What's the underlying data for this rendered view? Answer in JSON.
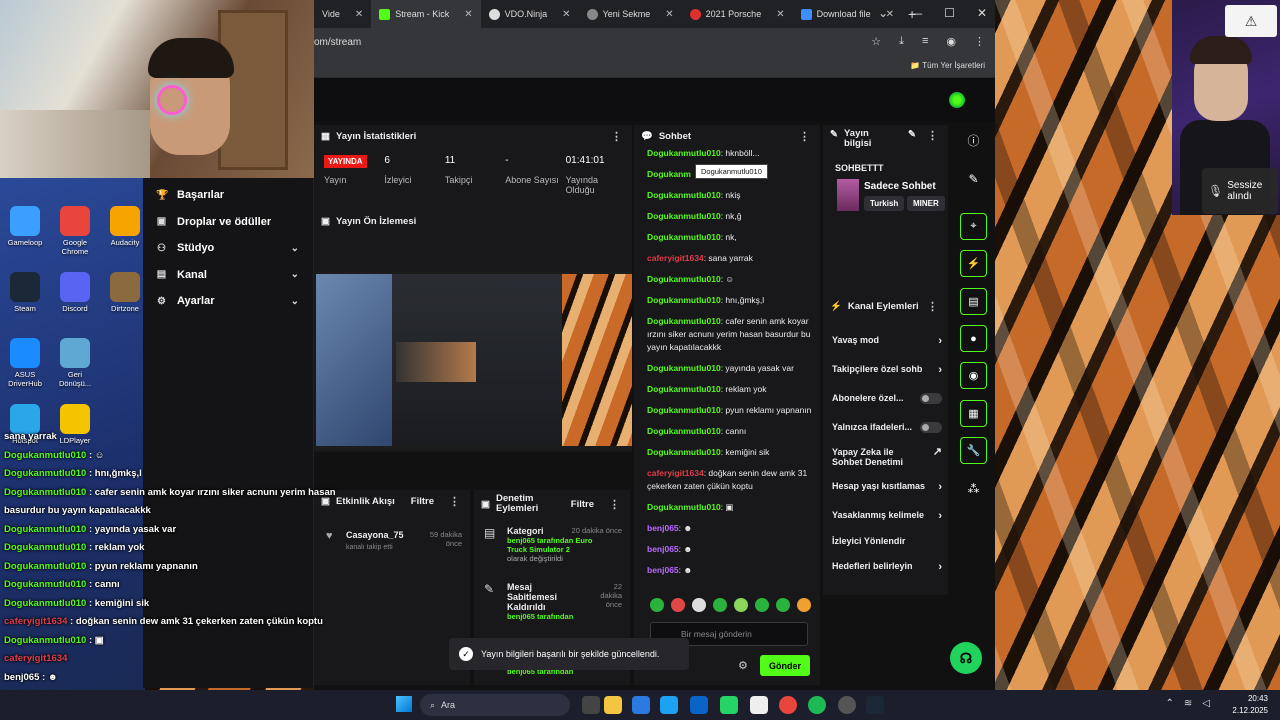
{
  "browser": {
    "tabs": [
      {
        "label": "Vide",
        "active": false
      },
      {
        "label": "Stream - Kick",
        "active": true
      },
      {
        "label": "VDO.Ninja",
        "active": false
      },
      {
        "label": "Yeni Sekme",
        "active": false
      },
      {
        "label": "2021 Porsche",
        "active": false
      },
      {
        "label": "Download file",
        "active": false
      }
    ],
    "url": "om/stream",
    "bookmarks_all": "Tüm Yer İşaretleri"
  },
  "sidemenu": {
    "items": [
      {
        "label": "Başarılar",
        "icon": "trophy-icon"
      },
      {
        "label": "Droplar ve ödüller",
        "icon": "gift-icon"
      },
      {
        "label": "Stüdyo",
        "icon": "studio-icon"
      },
      {
        "label": "Kanal",
        "icon": "channel-icon"
      },
      {
        "label": "Ayarlar",
        "icon": "gear-icon"
      }
    ]
  },
  "stats": {
    "title": "Yayın İstatistikleri",
    "live_label": "YAYINDA",
    "live_caption": "Yayın",
    "viewers": "6",
    "viewers_label": "İzleyici",
    "followers": "11",
    "followers_label": "Takipçi",
    "subs": "-",
    "subs_label": "Abone Sayısı",
    "duration": "01:41:01",
    "duration_label": "Yayında Olduğu"
  },
  "preview": {
    "title": "Yayın Ön İzlemesi"
  },
  "activity": {
    "title": "Etkinlik Akışı",
    "filter": "Filtre",
    "item_name": "Casayona_75",
    "item_sub": "kanalı takip etti",
    "item_time": "59 dakika önce"
  },
  "moderation": {
    "title": "Denetim Eylemleri",
    "filter": "Filtre",
    "items": [
      {
        "title": "Kategori",
        "who": "benj065 tarafından Euro Truck Simulator 2",
        "desc": "olarak değiştirildi",
        "time": "20 dakika önce"
      },
      {
        "title": "Mesaj Sabitlemesi Kaldırıldı",
        "who": "benj065 tarafından",
        "desc": "",
        "time": "22 dakika önce"
      }
    ],
    "extra_who": "benj065 tarafından"
  },
  "chat": {
    "title": "Sohbet",
    "tooltip": "Dogukanmutlu010",
    "messages": [
      {
        "user": "Dogukanmutlu010",
        "text": ": hknböll...",
        "color": "green"
      },
      {
        "user": "Dogukanm",
        "text": "",
        "color": "green"
      },
      {
        "user": "Dogukanmutlu010",
        "text": ": nkiş",
        "color": "green"
      },
      {
        "user": "Dogukanmutlu010",
        "text": ": nk,ğ",
        "color": "green"
      },
      {
        "user": "Dogukanmutlu010",
        "text": ": nk,",
        "color": "green"
      },
      {
        "user": "caferyigit1634",
        "text": ": sana yarrak",
        "color": "red"
      },
      {
        "user": "Dogukanmutlu010",
        "text": ": ☺",
        "color": "green"
      },
      {
        "user": "Dogukanmutlu010",
        "text": ": hnı,ğmkş,l",
        "color": "green"
      },
      {
        "user": "Dogukanmutlu010",
        "text": ": cafer senin amk koyar ırzını siker acnunı yerim hasan basurdur bu yayın kapatılacakkk",
        "color": "green"
      },
      {
        "user": "Dogukanmutlu010",
        "text": ": yayında yasak var",
        "color": "green"
      },
      {
        "user": "Dogukanmutlu010",
        "text": ": reklam yok",
        "color": "green"
      },
      {
        "user": "Dogukanmutlu010",
        "text": ": pyun reklamı yapnanın",
        "color": "green"
      },
      {
        "user": "Dogukanmutlu010",
        "text": ": cannı",
        "color": "green"
      },
      {
        "user": "Dogukanmutlu010",
        "text": ": kemiğini sik",
        "color": "green"
      },
      {
        "user": "caferyigit1634",
        "text": ": doğkan senin dew amk 31 çekerken zaten çükün koptu",
        "color": "red"
      },
      {
        "user": "Dogukanmutlu010",
        "text": ": ▣",
        "color": "green"
      },
      {
        "user": "benj065",
        "text": ": ☻",
        "color": "purple"
      },
      {
        "user": "benj065",
        "text": ": ☻",
        "color": "purple"
      },
      {
        "user": "benj065",
        "text": ": ☻",
        "color": "purple"
      }
    ],
    "input_placeholder": "Bir mesaj gönderin",
    "send": "Gönder"
  },
  "info": {
    "title_line1": "Yayın",
    "title_line2": "bilgisi",
    "stream_title": "SOHBETTT",
    "category": "Sadece Sohbet",
    "tags": [
      "Turkish",
      "MINER"
    ]
  },
  "actions": {
    "title": "Kanal Eylemleri",
    "items": [
      {
        "label": "Yavaş mod",
        "kind": "chevron"
      },
      {
        "label": "Takipçilere özel sohb",
        "kind": "chevron"
      },
      {
        "label": "Abonelere özel...",
        "kind": "toggle"
      },
      {
        "label": "Yalnızca ifadeleri...",
        "kind": "toggle"
      },
      {
        "label": "Yapay Zeka ile Sohbet Denetimi",
        "kind": "external"
      },
      {
        "label": "Hesap yaşı kısıtlamas",
        "kind": "chevron"
      },
      {
        "label": "Yasaklanmış kelimele",
        "kind": "chevron"
      },
      {
        "label": "İzleyici Yönlendir",
        "kind": "none"
      },
      {
        "label": "Hedefleri belirleyin",
        "kind": "chevron"
      }
    ]
  },
  "toast": {
    "text": "Yayın bilgileri başarılı bir şekilde güncellendi."
  },
  "webcam": {
    "mute_text": "Sessize alındı"
  },
  "desktop_icons": [
    {
      "label": "Gameloop",
      "color": "#3aa0ff"
    },
    {
      "label": "Google Chrome",
      "color": "#e8453c"
    },
    {
      "label": "Audacity",
      "color": "#f7a400"
    },
    {
      "label": "Steam",
      "color": "#1b2838"
    },
    {
      "label": "Discord",
      "color": "#5865f2"
    },
    {
      "label": "Dirtzone",
      "color": "#8c6a40"
    },
    {
      "label": "ASUS DriverHub",
      "color": "#1a8cff"
    },
    {
      "label": "Geri Dönüşü...",
      "color": "#5fa8d3"
    },
    {
      "label": "Hotspot",
      "color": "#2aa7e8"
    },
    {
      "label": "LDPlayer",
      "color": "#f5c400"
    }
  ],
  "overlay_chat": [
    {
      "user": "",
      "text": "sana yarrak",
      "color": "red"
    },
    {
      "user": "Dogukanmutlu010",
      "text": " : ☺",
      "color": "green"
    },
    {
      "user": "Dogukanmutlu010",
      "text": " : hnı,ğmkş,l",
      "color": "green"
    },
    {
      "user": "Dogukanmutlu010",
      "text": " : cafer senin amk koyar ırzını siker acnunı yerim hasan",
      "color": "green"
    },
    {
      "user": "",
      "text": "basurdur bu yayın kapatılacakkk",
      "color": "green"
    },
    {
      "user": "Dogukanmutlu010",
      "text": " : yayında yasak var",
      "color": "green"
    },
    {
      "user": "Dogukanmutlu010",
      "text": " : reklam yok",
      "color": "green"
    },
    {
      "user": "Dogukanmutlu010",
      "text": " : pyun reklamı yapnanın",
      "color": "green"
    },
    {
      "user": "Dogukanmutlu010",
      "text": " : cannı",
      "color": "green"
    },
    {
      "user": "Dogukanmutlu010",
      "text": " : kemiğini sik",
      "color": "green"
    },
    {
      "user": "caferyigit1634",
      "text": " : doğkan senin dew amk 31 çekerken zaten çükün koptu",
      "color": "red"
    },
    {
      "user": "Dogukanmutlu010",
      "text": " : ▣",
      "color": "green"
    },
    {
      "user": "caferyigit1634",
      "text": "",
      "color": "red"
    },
    {
      "user": "benj065",
      "text": " : ☻",
      "color": "white"
    },
    {
      "user": "benj065",
      "text": " : ☻",
      "color": "white"
    },
    {
      "user": "benj065",
      "text": " : ☻",
      "color": "white"
    }
  ],
  "taskbar": {
    "search": "Ara",
    "time": "20:43",
    "date": "2.12.2025"
  }
}
